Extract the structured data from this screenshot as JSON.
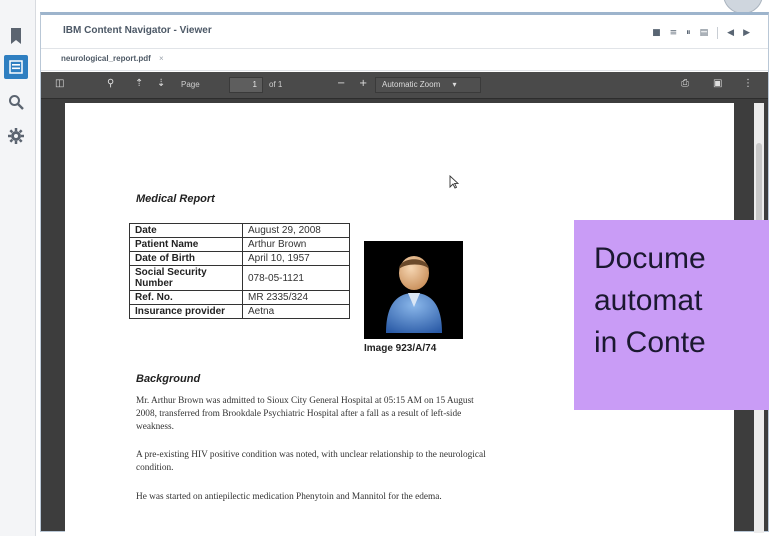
{
  "app": {
    "title": "IBM Content Navigator - Viewer"
  },
  "nav_rail": {
    "items": [
      {
        "icon": "bookmark-icon",
        "active": false
      },
      {
        "icon": "browse-icon",
        "active": true
      },
      {
        "icon": "search-icon",
        "active": false
      },
      {
        "icon": "gear-icon",
        "active": false
      }
    ],
    "accent": "#2f7fc1"
  },
  "viewer": {
    "layout_buttons": [
      "layout-single-icon",
      "layout-list-icon",
      "layout-split-icon",
      "layout-side-icon"
    ],
    "nav_prev": "◀",
    "nav_next": "▶",
    "tab": {
      "label": "neurological_report.pdf",
      "close": "×"
    }
  },
  "pdf_toolbar": {
    "page_label": "Page",
    "page_value": "1",
    "page_count": "of 1",
    "zoom_out": "−",
    "zoom_in": "+",
    "zoom_value": "Automatic Zoom",
    "background": "#4a4a4a"
  },
  "document": {
    "title": "Medical Report",
    "table": [
      {
        "key": "Date",
        "value": "August 29, 2008"
      },
      {
        "key": "Patient Name",
        "value": "Arthur Brown"
      },
      {
        "key": "Date of Birth",
        "value": "April 10, 1957"
      },
      {
        "key": "Social Security Number",
        "value": "078-05-1121"
      },
      {
        "key": "Ref. No.",
        "value": "MR 2335/324"
      },
      {
        "key": "Insurance provider",
        "value": "Aetna"
      }
    ],
    "image_caption": "Image 923/A/74",
    "section_heading": "Background",
    "paragraphs": [
      "Mr. Arthur Brown was admitted to Sioux City General Hospital at 05:15 AM on 15 August 2008, transferred from Brookdale Psychiatric Hospital after a fall as a result of left-side weakness.",
      "A pre-existing HIV positive condition was noted, with unclear relationship to the neurological condition.",
      "He was started on antiepilectic medication Phenytoin and Mannitol for the edema."
    ]
  },
  "overlay": {
    "lines": [
      "Docume",
      "automat",
      "in Conte"
    ],
    "color": "#c99cf6"
  }
}
